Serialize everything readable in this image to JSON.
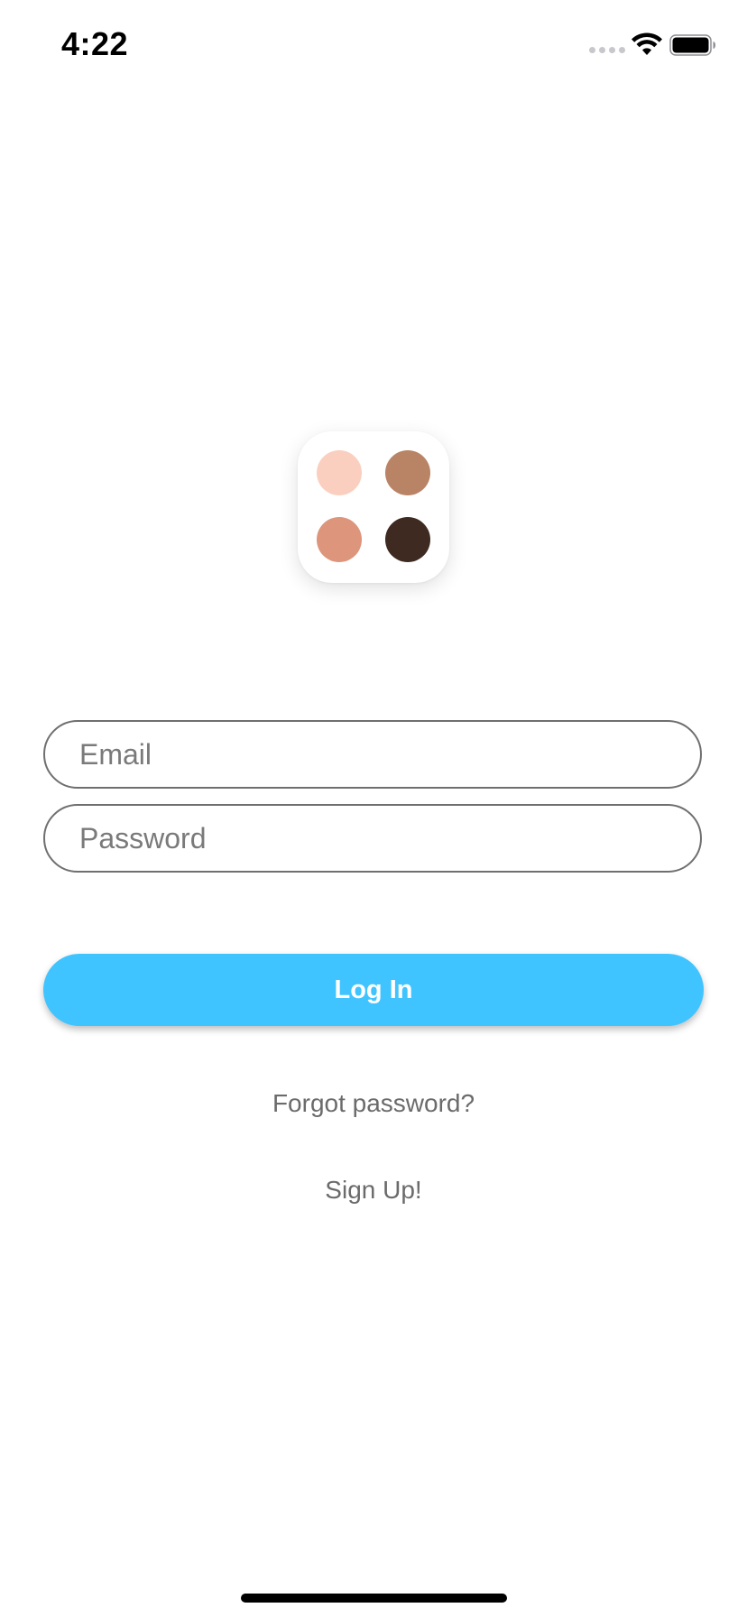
{
  "status_bar": {
    "time": "4:22",
    "signal_icon": "cellular-signal-dots-icon",
    "wifi_icon": "wifi-icon",
    "battery_icon": "battery-full-icon"
  },
  "logo": {
    "icon": "skin-tone-palette-icon",
    "swatch_colors": [
      "#fbcfbf",
      "#b98466",
      "#dd957b",
      "#3f2a22"
    ]
  },
  "form": {
    "email_placeholder": "Email",
    "email_value": "",
    "password_placeholder": "Password",
    "password_value": "",
    "login_label": "Log In",
    "forgot_label": "Forgot password?",
    "signup_label": "Sign Up!"
  },
  "colors": {
    "accent": "#40c4ff",
    "link_text": "#6b6b6b",
    "field_border": "#6f6f6f"
  }
}
